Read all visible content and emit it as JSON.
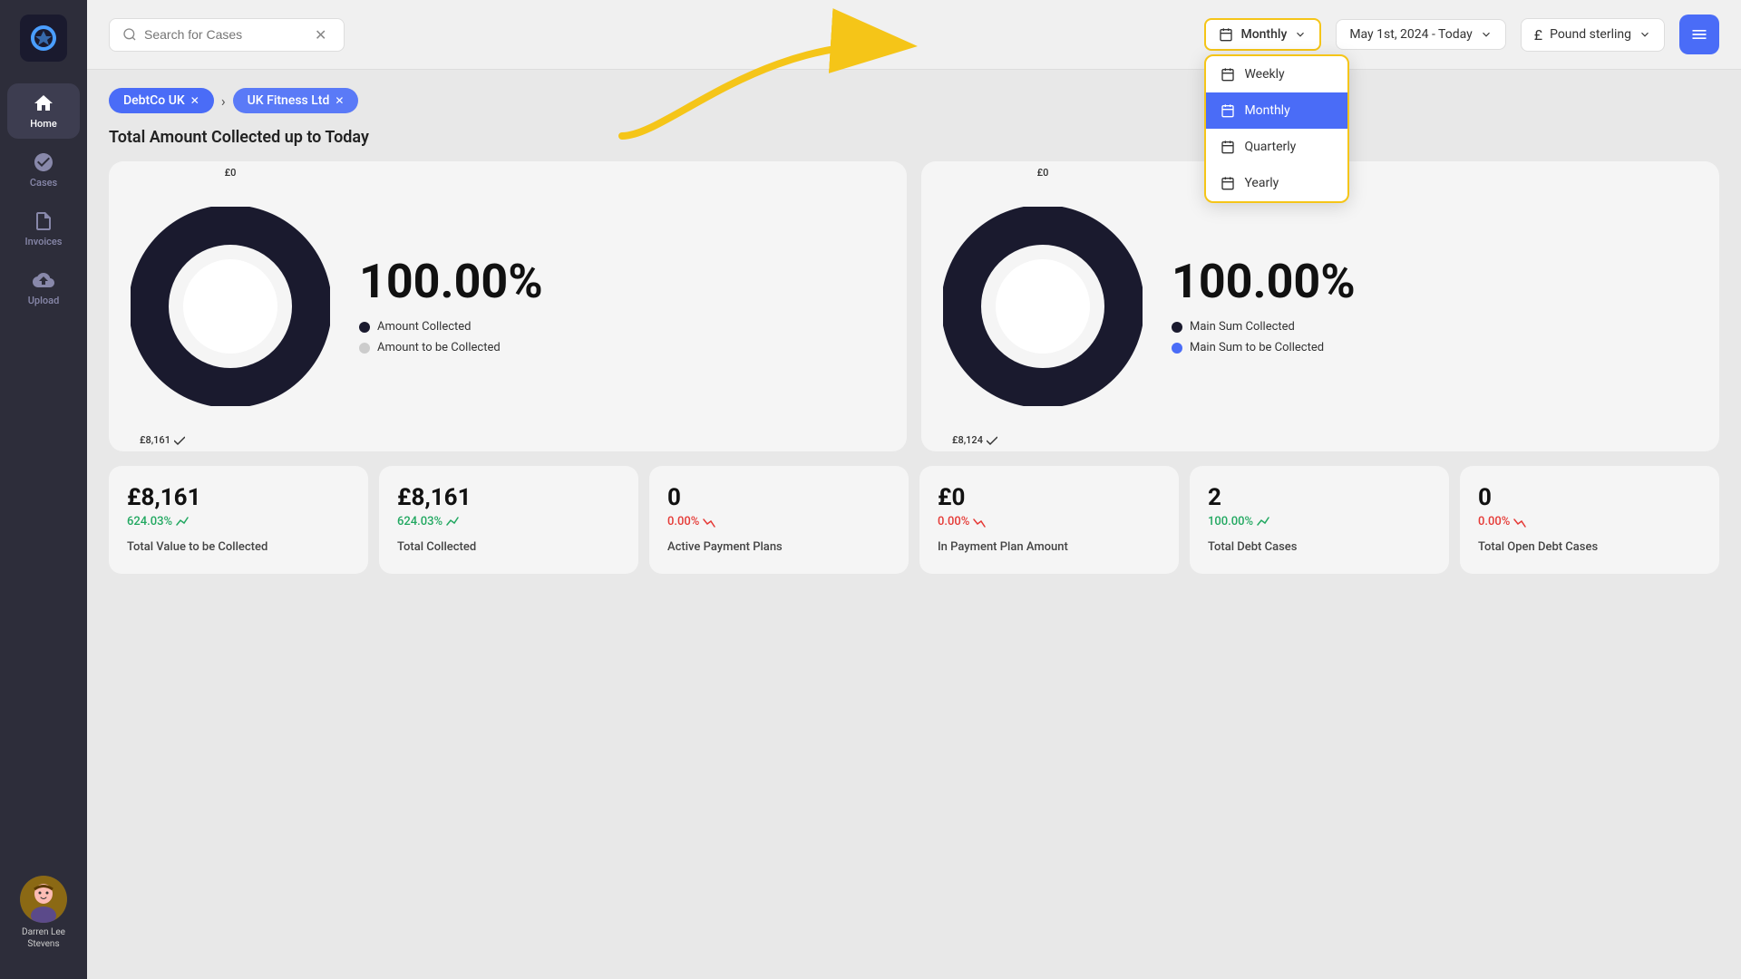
{
  "sidebar": {
    "logo_alt": "Collectify Logo",
    "nav_items": [
      {
        "id": "home",
        "label": "Home",
        "active": true
      },
      {
        "id": "cases",
        "label": "Cases",
        "active": false
      },
      {
        "id": "invoices",
        "label": "Invoices",
        "active": false
      },
      {
        "id": "upload",
        "label": "Upload",
        "active": false
      }
    ],
    "user": {
      "name": "Darren Lee Stevens",
      "avatar_alt": "User avatar"
    }
  },
  "header": {
    "search_placeholder": "Search for Cases",
    "period_label": "Monthly",
    "period_options": [
      {
        "id": "weekly",
        "label": "Weekly",
        "selected": false
      },
      {
        "id": "monthly",
        "label": "Monthly",
        "selected": true
      },
      {
        "id": "quarterly",
        "label": "Quarterly",
        "selected": false
      },
      {
        "id": "yearly",
        "label": "Yearly",
        "selected": false
      }
    ],
    "date_range": "May 1st, 2024 - Today",
    "currency": "Pound sterling"
  },
  "breadcrumbs": [
    {
      "label": "DebtCo UK",
      "active": true
    },
    {
      "label": "UK Fitness Ltd",
      "active": true
    }
  ],
  "page_title": "Total Amount Collected up to Today",
  "charts": [
    {
      "id": "chart1",
      "percent": "100.00%",
      "top_label": "£0",
      "bottom_label": "£8,161",
      "legend": [
        {
          "label": "Amount Collected",
          "style": "dark"
        },
        {
          "label": "Amount to be Collected",
          "style": "light"
        }
      ]
    },
    {
      "id": "chart2",
      "percent": "100.00%",
      "top_label": "£0",
      "bottom_label": "£8,124",
      "legend": [
        {
          "label": "Main Sum Collected",
          "style": "dark"
        },
        {
          "label": "Main Sum to be Collected",
          "style": "blue"
        }
      ]
    }
  ],
  "stats": [
    {
      "value": "£8,161",
      "change": "624.03%",
      "change_type": "positive",
      "label": "Total Value to be Collected"
    },
    {
      "value": "£8,161",
      "change": "624.03%",
      "change_type": "positive",
      "label": "Total Collected"
    },
    {
      "value": "0",
      "change": "0.00%",
      "change_type": "negative",
      "label": "Active Payment Plans"
    },
    {
      "value": "£0",
      "change": "0.00%",
      "change_type": "negative",
      "label": "In Payment Plan Amount"
    },
    {
      "value": "2",
      "change": "100.00%",
      "change_type": "positive",
      "label": "Total Debt Cases"
    },
    {
      "value": "0",
      "change": "0.00%",
      "change_type": "negative",
      "label": "Total Open Debt Cases"
    }
  ]
}
